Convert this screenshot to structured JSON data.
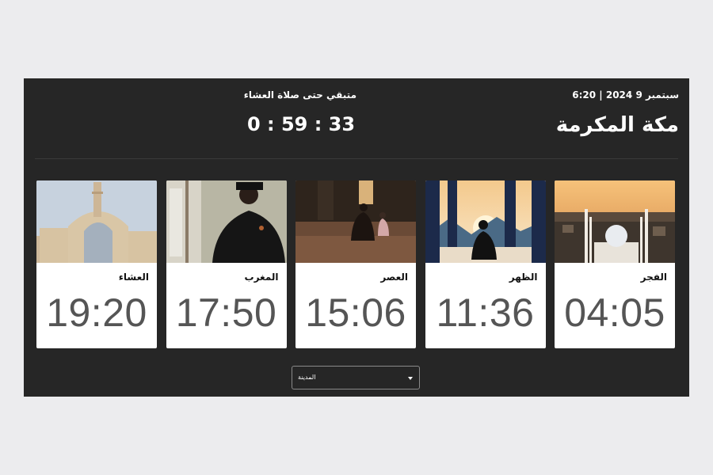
{
  "header": {
    "date_line": "سبتمبر 9 2024 | 6:20",
    "city": "مكة المكرمة",
    "remaining_label": "متبقي حتى صلاة العشاء",
    "countdown": "0 : 59 : 33"
  },
  "prayers": [
    {
      "name": "الفجر",
      "time": "04:05",
      "image": "mosque-dome-aerial-image"
    },
    {
      "name": "الظهر",
      "time": "11:36",
      "image": "person-praying-sunset-image"
    },
    {
      "name": "العصر",
      "time": "15:06",
      "image": "father-child-praying-image"
    },
    {
      "name": "المغرب",
      "time": "17:50",
      "image": "man-at-window-image"
    },
    {
      "name": "العشاء",
      "time": "19:20",
      "image": "mosque-arch-image"
    }
  ],
  "city_select": {
    "selected": "المدينة",
    "icon": "chevron-down-icon"
  },
  "colors": {
    "page_bg": "#ececee",
    "panel_bg": "#262626",
    "card_bg": "#ffffff",
    "time_text": "#555555"
  }
}
